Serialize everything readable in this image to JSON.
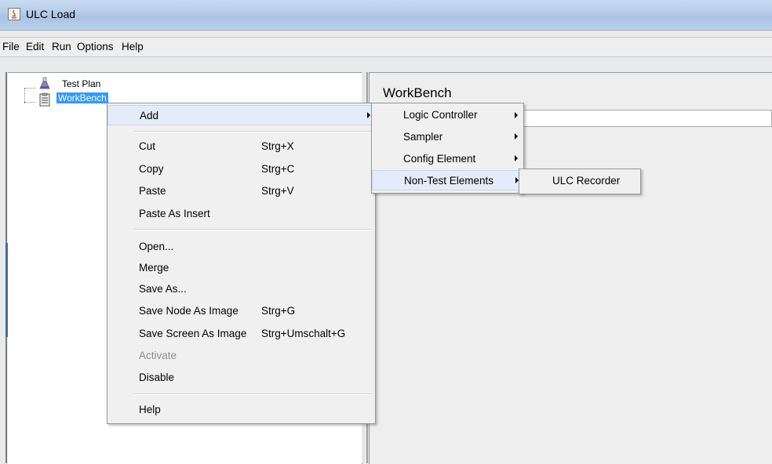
{
  "window": {
    "title": "ULC Load"
  },
  "menubar": {
    "items": [
      "File",
      "Edit",
      "Run",
      "Options",
      "Help"
    ]
  },
  "tree": {
    "nodes": [
      {
        "label": "Test Plan",
        "icon": "flask-icon",
        "selected": false
      },
      {
        "label": "WorkBench",
        "icon": "clipboard-icon",
        "selected": true
      }
    ]
  },
  "right_panel": {
    "title": "WorkBench"
  },
  "context_menu": {
    "add": "Add",
    "cut": "Cut",
    "cut_shortcut": "Strg+X",
    "copy": "Copy",
    "copy_shortcut": "Strg+C",
    "paste": "Paste",
    "paste_shortcut": "Strg+V",
    "paste_as_insert": "Paste As Insert",
    "open": "Open...",
    "merge": "Merge",
    "save_as": "Save As...",
    "save_node_image": "Save Node As Image",
    "save_node_image_shortcut": "Strg+G",
    "save_screen_image": "Save Screen As Image",
    "save_screen_image_shortcut": "Strg+Umschalt+G",
    "activate": "Activate",
    "disable": "Disable",
    "help": "Help"
  },
  "add_submenu": {
    "logic_controller": "Logic Controller",
    "sampler": "Sampler",
    "config_element": "Config Element",
    "non_test_elements": "Non-Test Elements"
  },
  "non_test_submenu": {
    "ulc_recorder": "ULC Recorder"
  },
  "colors": {
    "selection": "#3399ff",
    "menu_highlight": "#e3ecf8",
    "titlebar": "#b4cbe6"
  }
}
